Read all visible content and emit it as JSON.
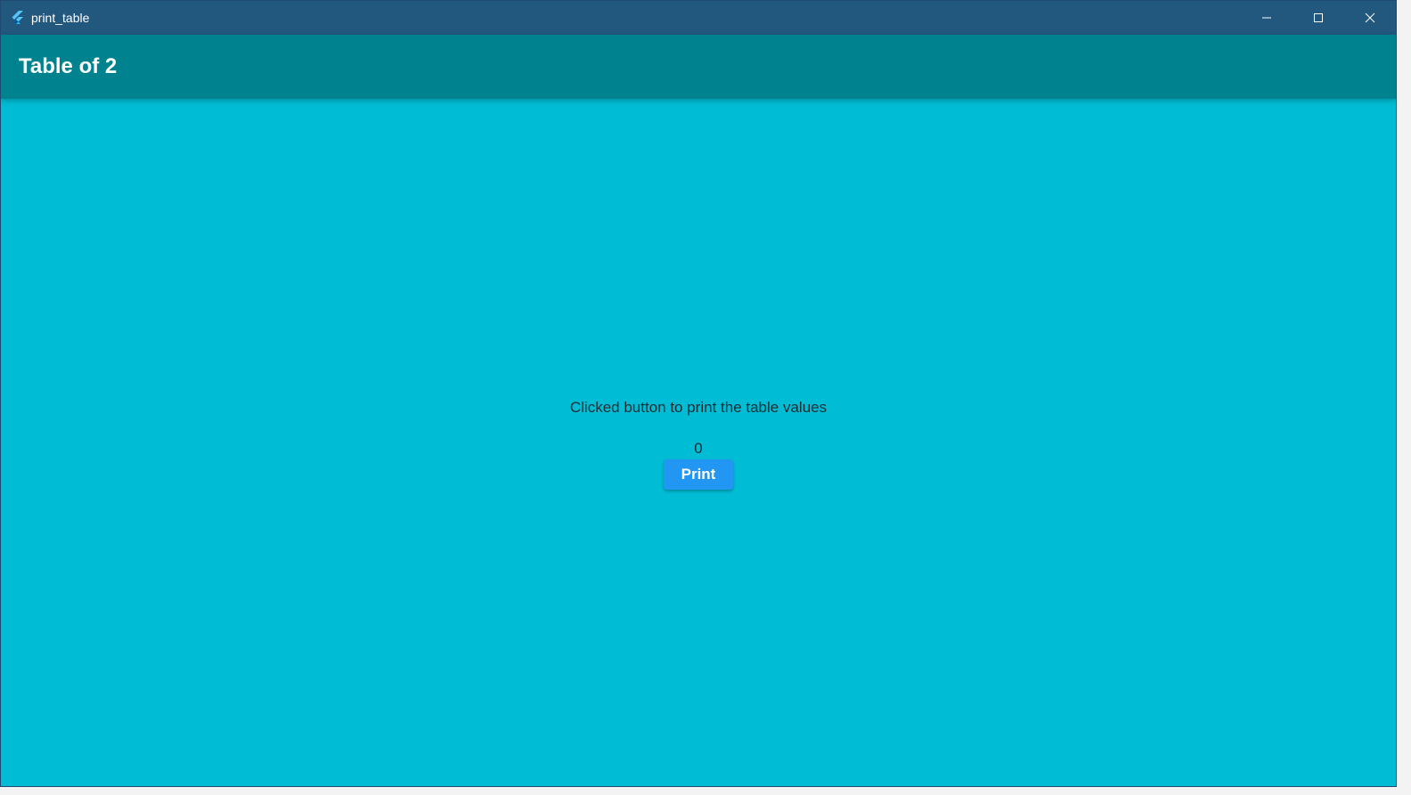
{
  "window": {
    "title": "print_table",
    "controls": {
      "minimize_icon": "minimize-icon",
      "maximize_icon": "maximize-icon",
      "close_icon": "close-icon"
    }
  },
  "appbar": {
    "title": "Table of 2"
  },
  "main": {
    "message": "Clicked button to print the table values",
    "counter": "0",
    "print_label": "Print"
  },
  "colors": {
    "titlebar": "#22577e",
    "appbar": "#00838f",
    "background": "#00bcd4",
    "button": "#2196f3"
  }
}
